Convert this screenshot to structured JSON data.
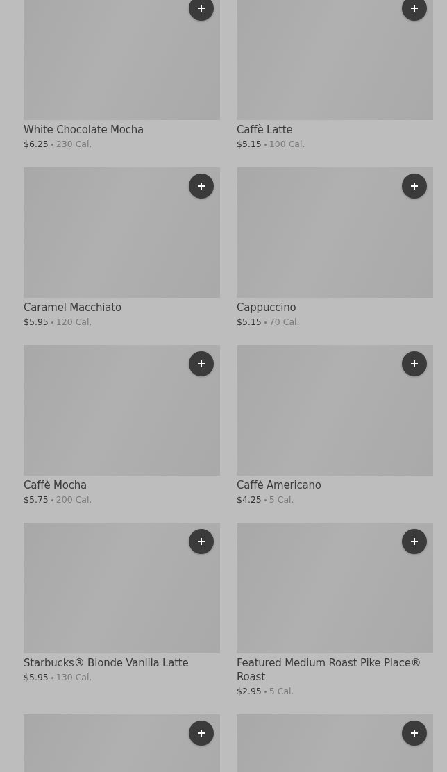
{
  "menu_items": [
    {
      "kind": "item",
      "name": "White Chocolate Mocha",
      "price": "$6.25",
      "calories": "230 Cal."
    },
    {
      "kind": "item",
      "name": "Caffè Latte",
      "price": "$5.15",
      "calories": "100 Cal."
    },
    {
      "kind": "item",
      "name": "Caramel Macchiato",
      "price": "$5.95",
      "calories": "120 Cal."
    },
    {
      "kind": "item",
      "name": "Cappuccino",
      "price": "$5.15",
      "calories": "70 Cal."
    },
    {
      "kind": "item",
      "name": "Caffè Mocha",
      "price": "$5.75",
      "calories": "200 Cal."
    },
    {
      "kind": "item",
      "name": "Caffè Americano",
      "price": "$4.25",
      "calories": "5 Cal."
    },
    {
      "kind": "item",
      "name": "Starbucks® Blonde Vanilla Latte",
      "price": "$5.95",
      "calories": "130 Cal."
    },
    {
      "kind": "item",
      "name": "Featured Medium Roast Pike Place® Roast",
      "price": "$2.95",
      "calories": "5 Cal."
    },
    {
      "kind": "image-only"
    },
    {
      "kind": "image-only"
    }
  ]
}
